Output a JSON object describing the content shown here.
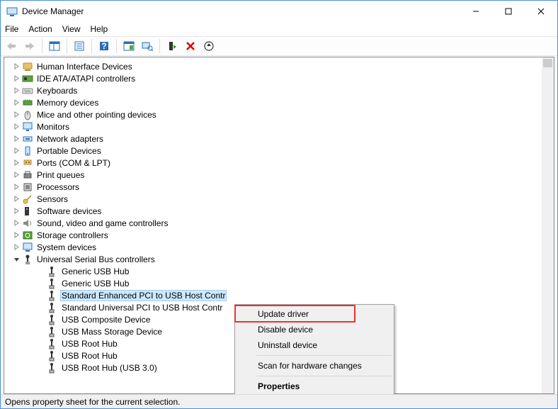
{
  "window": {
    "title": "Device Manager"
  },
  "menu": {
    "file": "File",
    "action": "Action",
    "view": "View",
    "help": "Help"
  },
  "nodes": [
    {
      "label": "Human Interface Devices",
      "icon": "hid"
    },
    {
      "label": "IDE ATA/ATAPI controllers",
      "icon": "ide"
    },
    {
      "label": "Keyboards",
      "icon": "keyboard"
    },
    {
      "label": "Memory devices",
      "icon": "memory"
    },
    {
      "label": "Mice and other pointing devices",
      "icon": "mouse"
    },
    {
      "label": "Monitors",
      "icon": "monitor"
    },
    {
      "label": "Network adapters",
      "icon": "network"
    },
    {
      "label": "Portable Devices",
      "icon": "portable"
    },
    {
      "label": "Ports (COM & LPT)",
      "icon": "port"
    },
    {
      "label": "Print queues",
      "icon": "printer"
    },
    {
      "label": "Processors",
      "icon": "cpu"
    },
    {
      "label": "Sensors",
      "icon": "sensor"
    },
    {
      "label": "Software devices",
      "icon": "software"
    },
    {
      "label": "Sound, video and game controllers",
      "icon": "sound"
    },
    {
      "label": "Storage controllers",
      "icon": "storage"
    },
    {
      "label": "System devices",
      "icon": "system"
    }
  ],
  "usb_category": "Universal Serial Bus controllers",
  "usb_children": [
    "Generic USB Hub",
    "Generic USB Hub",
    "Standard Enhanced PCI to USB Host Contr",
    "Standard Universal PCI to USB Host Contr",
    "USB Composite Device",
    "USB Mass Storage Device",
    "USB Root Hub",
    "USB Root Hub",
    "USB Root Hub (USB 3.0)"
  ],
  "selected_child_index": 2,
  "context": {
    "update": "Update driver",
    "disable": "Disable device",
    "uninstall": "Uninstall device",
    "scan": "Scan for hardware changes",
    "properties": "Properties"
  },
  "status": "Opens property sheet for the current selection."
}
